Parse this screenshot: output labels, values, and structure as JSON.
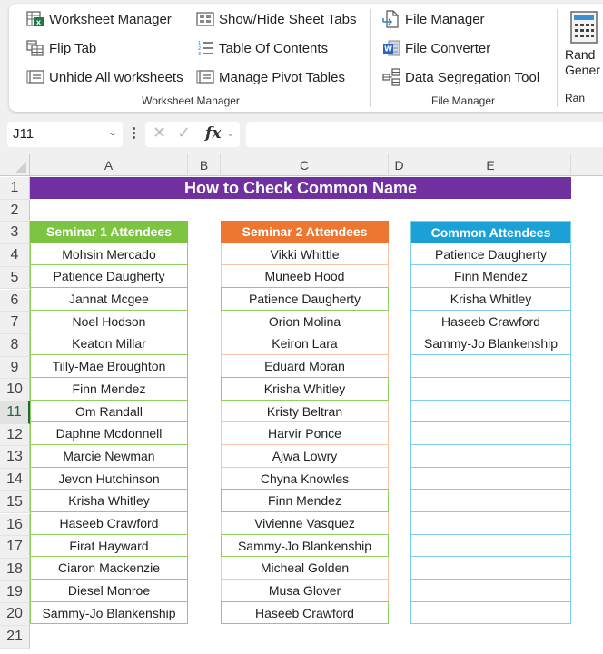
{
  "ribbon": {
    "groups": [
      {
        "label": "Worksheet Manager",
        "items": [
          {
            "label": "Worksheet Manager",
            "icon": "worksheet-manager-icon"
          },
          {
            "label": "Flip Tab",
            "icon": "flip-tab-icon"
          },
          {
            "label": "Unhide All worksheets",
            "icon": "unhide-worksheets-icon"
          },
          {
            "label": "Show/Hide Sheet Tabs",
            "icon": "sheet-tabs-icon"
          },
          {
            "label": "Table Of Contents",
            "icon": "numbered-list-icon"
          },
          {
            "label": "Manage Pivot Tables",
            "icon": "pivot-tables-icon"
          }
        ]
      },
      {
        "label": "File Manager",
        "items": [
          {
            "label": "File Manager",
            "icon": "file-manager-icon"
          },
          {
            "label": "File Converter",
            "icon": "word-file-icon"
          },
          {
            "label": "Data Segregation Tool",
            "icon": "data-segregation-icon"
          }
        ]
      },
      {
        "label": "Ran",
        "items": [
          {
            "label_line1": "Rand",
            "label_line2": "Gener",
            "icon": "random-generator-icon"
          }
        ]
      }
    ]
  },
  "formula_bar": {
    "name_box": "J11",
    "fx_label": "fx",
    "formula_value": ""
  },
  "sheet": {
    "columns": [
      "A",
      "B",
      "C",
      "D",
      "E"
    ],
    "rows": [
      "1",
      "2",
      "3",
      "4",
      "5",
      "6",
      "7",
      "8",
      "9",
      "10",
      "11",
      "12",
      "13",
      "14",
      "15",
      "16",
      "17",
      "18",
      "19",
      "20",
      "21"
    ],
    "selected_row": "11",
    "title": "How to Check Common Name",
    "tables": {
      "seminar1": {
        "header": "Seminar 1 Attendees",
        "color": "#7dc443",
        "names": [
          "Mohsin Mercado",
          "Patience Daugherty",
          "Jannat Mcgee",
          "Noel Hodson",
          "Keaton Millar",
          "Tilly-Mae Broughton",
          "Finn Mendez",
          "Om Randall",
          "Daphne Mcdonnell",
          "Marcie Newman",
          "Jevon Hutchinson",
          "Krisha Whitley",
          "Haseeb Crawford",
          "Firat Hayward",
          "Ciaron Mackenzie",
          "Diesel Monroe",
          "Sammy-Jo Blankenship"
        ]
      },
      "seminar2": {
        "header": "Seminar 2 Attendees",
        "color": "#ed7631",
        "names": [
          "Vikki Whittle",
          "Muneeb Hood",
          "Patience Daugherty",
          "Orion Molina",
          "Keiron Lara",
          "Eduard Moran",
          "Krisha Whitley",
          "Kristy Beltran",
          "Harvir Ponce",
          "Ajwa Lowry",
          "Chyna Knowles",
          "Finn Mendez",
          "Vivienne Vasquez",
          "Sammy-Jo Blankenship",
          "Micheal Golden",
          "Musa Glover",
          "Haseeb Crawford"
        ],
        "highlighted": [
          false,
          false,
          true,
          false,
          false,
          false,
          true,
          false,
          false,
          false,
          false,
          true,
          false,
          true,
          false,
          false,
          true
        ]
      },
      "common": {
        "header": "Common Attendees",
        "color": "#1ba1d6",
        "names": [
          "Patience Daugherty",
          "Finn Mendez",
          "Krisha Whitley",
          "Haseeb Crawford",
          "Sammy-Jo Blankenship",
          "",
          "",
          "",
          "",
          "",
          "",
          "",
          "",
          "",
          "",
          "",
          ""
        ]
      }
    }
  }
}
